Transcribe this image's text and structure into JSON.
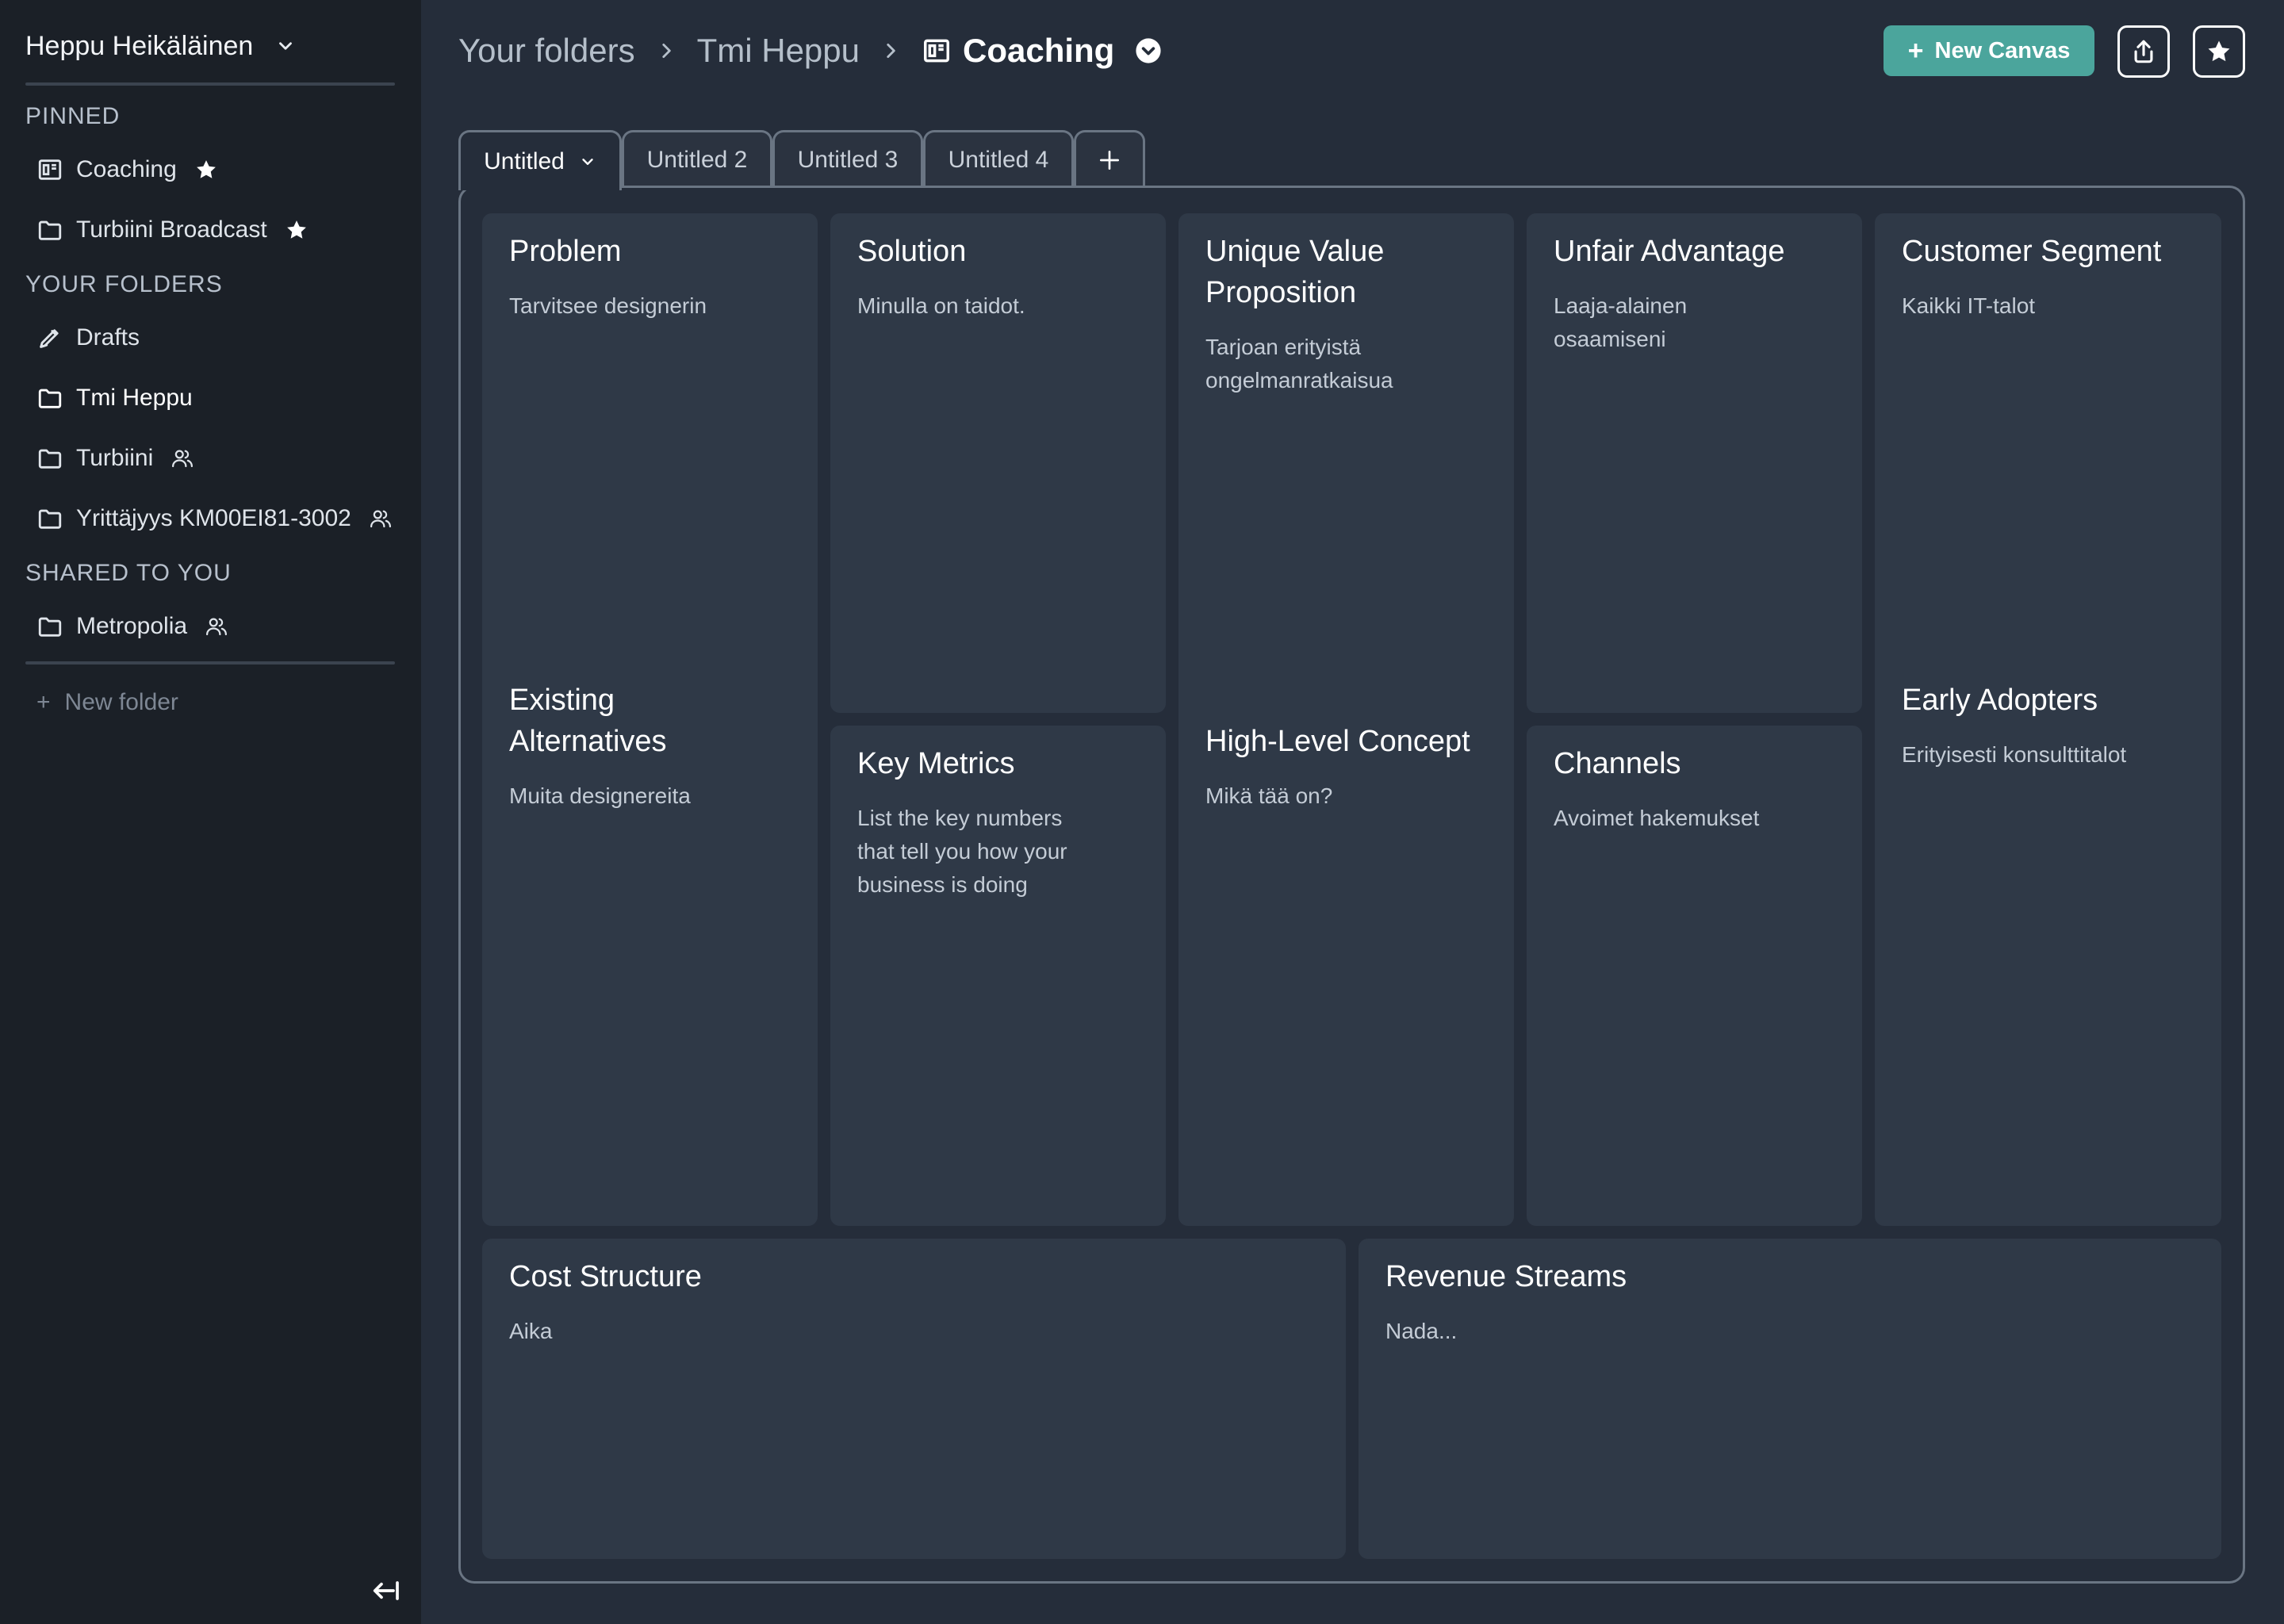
{
  "sidebar": {
    "user_name": "Heppu Heikäläinen",
    "sections": {
      "pinned": "PINNED",
      "your_folders": "YOUR FOLDERS",
      "shared": "SHARED TO YOU"
    },
    "pinned": [
      {
        "label": "Coaching",
        "icon": "canvas-icon",
        "starred": true
      },
      {
        "label": "Turbiini Broadcast",
        "icon": "folder-icon",
        "starred": true
      }
    ],
    "folders": [
      {
        "label": "Drafts",
        "icon": "pencil-icon"
      },
      {
        "label": "Tmi Heppu",
        "icon": "folder-icon"
      },
      {
        "label": "Turbiini",
        "icon": "folder-icon",
        "shared": true
      },
      {
        "label": "Yrittäjyys KM00EI81-3002",
        "icon": "folder-icon",
        "shared": true
      }
    ],
    "shared": [
      {
        "label": "Metropolia",
        "icon": "folder-icon",
        "shared": true
      }
    ],
    "new_folder": "New folder"
  },
  "header": {
    "breadcrumb": [
      "Your folders",
      "Tmi Heppu",
      "Coaching"
    ],
    "new_canvas_label": "New Canvas"
  },
  "tabs": [
    {
      "label": "Untitled",
      "active": true
    },
    {
      "label": "Untitled 2"
    },
    {
      "label": "Untitled 3"
    },
    {
      "label": "Untitled 4"
    }
  ],
  "canvas": {
    "problem": {
      "title": "Problem",
      "text": "Tarvitsee designerin"
    },
    "existing_alternatives": {
      "title": "Existing Alternatives",
      "text": "Muita designereita"
    },
    "solution": {
      "title": "Solution",
      "text": "Minulla on taidot."
    },
    "key_metrics": {
      "title": "Key Metrics",
      "text": "List the key numbers that tell you how your business is doing"
    },
    "uvp": {
      "title": "Unique Value Proposition",
      "text": "Tarjoan erityistä ongelmanratkaisua"
    },
    "high_level_concept": {
      "title": "High-Level Concept",
      "text": "Mikä tää on?"
    },
    "unfair_advantage": {
      "title": "Unfair Advantage",
      "text": "Laaja-alainen osaamiseni"
    },
    "channels": {
      "title": "Channels",
      "text": "Avoimet hakemukset"
    },
    "customer_segment": {
      "title": "Customer Segment",
      "text": "Kaikki IT-talot"
    },
    "early_adopters": {
      "title": "Early Adopters",
      "text": "Erityisesti konsulttitalot"
    },
    "cost_structure": {
      "title": "Cost Structure",
      "text": "Aika"
    },
    "revenue_streams": {
      "title": "Revenue Streams",
      "text": "Nada..."
    }
  },
  "colors": {
    "accent": "#4ba59c",
    "sidebar_bg": "#1b2027",
    "main_bg": "#252d3a",
    "card_bg": "#2f3947"
  }
}
